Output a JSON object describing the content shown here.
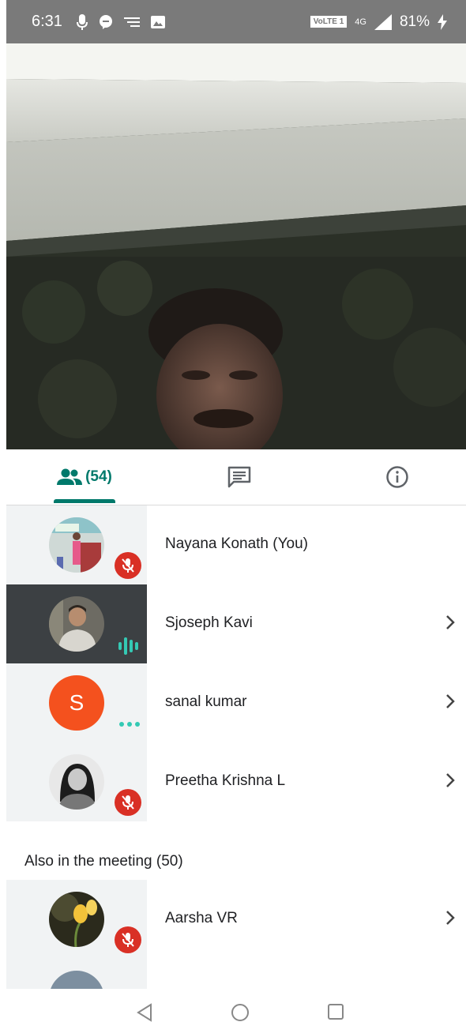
{
  "status_bar": {
    "time": "6:31",
    "volte": "VoLTE 1",
    "network": "4G",
    "battery": "81%",
    "icons_left": [
      "mic-icon",
      "chat-bubble-icon",
      "cast-icon",
      "image-icon"
    ]
  },
  "tabs": {
    "people_count": "(54)",
    "active": "people"
  },
  "participants": [
    {
      "name": "Nayana Konath (You)",
      "status": "muted",
      "has_chevron": false
    },
    {
      "name": "Sjoseph Kavi",
      "status": "speaking",
      "has_chevron": true
    },
    {
      "name": "sanal kumar",
      "status": "connecting",
      "avatar_letter": "S",
      "has_chevron": true
    },
    {
      "name": "Preetha Krishna L",
      "status": "muted",
      "has_chevron": true
    }
  ],
  "also_in_meeting_label": "Also in the meeting (50)",
  "also_participants": [
    {
      "name": "Aarsha VR",
      "status": "muted",
      "has_chevron": true
    }
  ],
  "colors": {
    "accent": "#00796b",
    "mute_red": "#d93025",
    "avatar_orange": "#f4511e",
    "speaking_tile": "#3c4043",
    "tile_bg": "#f1f3f4"
  }
}
